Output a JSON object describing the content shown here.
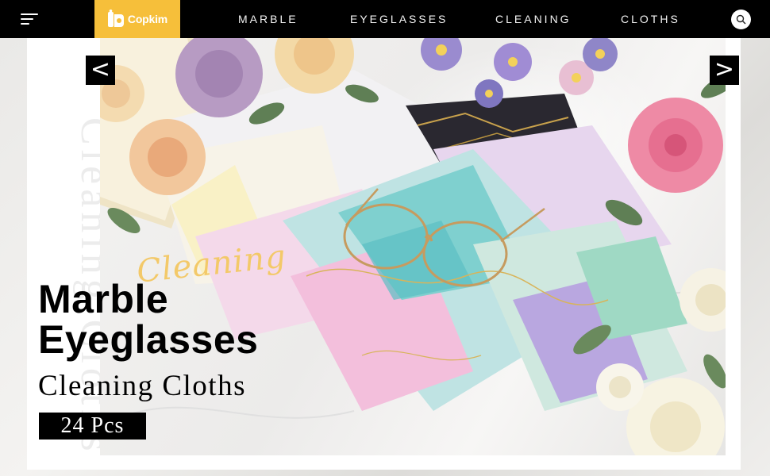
{
  "header": {
    "brand": "Copkim",
    "nav": [
      "MARBLE",
      "EYEGLASSES",
      "CLEANING",
      "CLOTHS"
    ]
  },
  "hero": {
    "vertical_text": "Cleaning Cloths",
    "script_text": "Cleaning",
    "title_line1": "Marble",
    "title_line2": "Eyeglasses",
    "subtitle": "Cleaning Cloths",
    "badge": "24 Pcs",
    "prev_label": "<",
    "next_label": ">"
  },
  "icons": {
    "menu": "hamburger-menu-icon",
    "search": "search-icon",
    "logo": "copkim-logo-icon"
  },
  "colors": {
    "nav_background": "#000000",
    "logo_background": "#f6bf3a",
    "script_accent": "#f3c969",
    "badge_background": "#000000"
  }
}
